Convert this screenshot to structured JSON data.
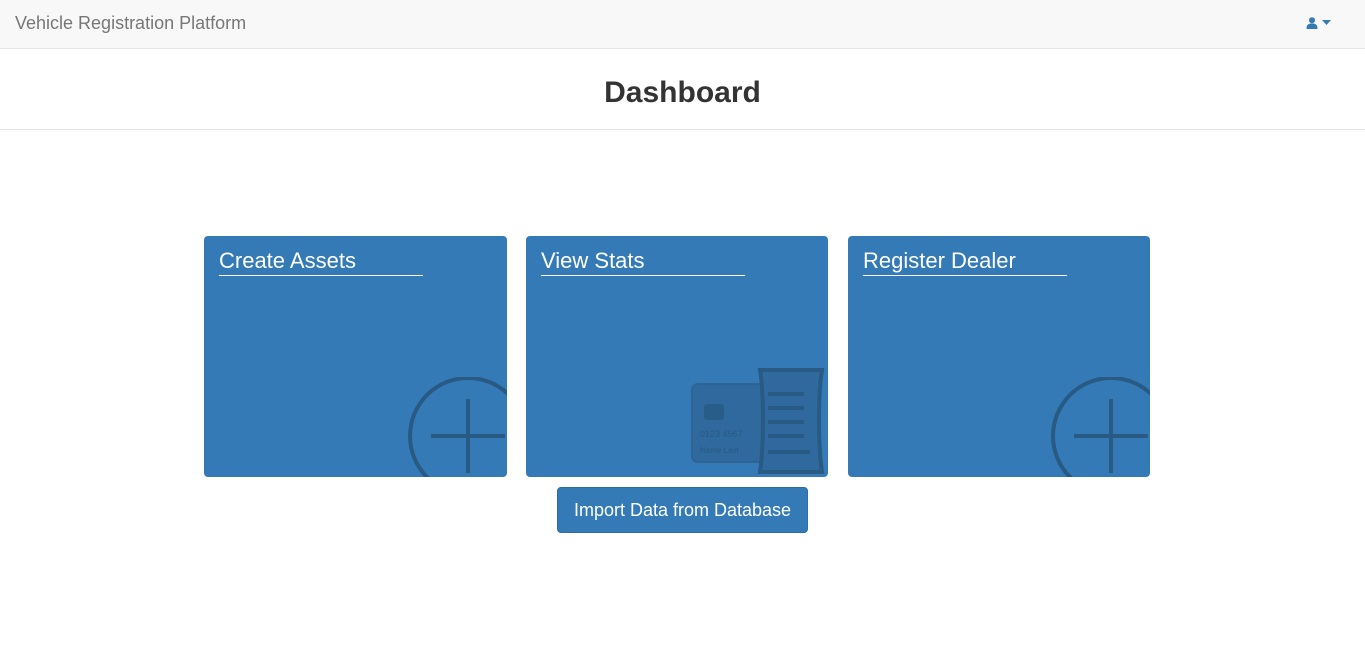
{
  "navbar": {
    "brand": "Vehicle Registration Platform",
    "user_icon": "user-icon",
    "caret_icon": "caret-down-icon"
  },
  "header": {
    "title": "Dashboard"
  },
  "tiles": [
    {
      "label": "Create Assets",
      "icon": "plus-circle-icon"
    },
    {
      "label": "View Stats",
      "icon": "credit-card-receipt-icon"
    },
    {
      "label": "Register Dealer",
      "icon": "plus-circle-icon"
    }
  ],
  "card_art": {
    "number": "0123 4567",
    "name": "Name Last"
  },
  "actions": {
    "import_label": "Import Data from Database"
  },
  "colors": {
    "primary": "#337ab7",
    "primary_border": "#2e6da4",
    "icon_dark": "#285a84",
    "navbar_bg": "#f8f8f8",
    "brand_text": "#777777"
  }
}
